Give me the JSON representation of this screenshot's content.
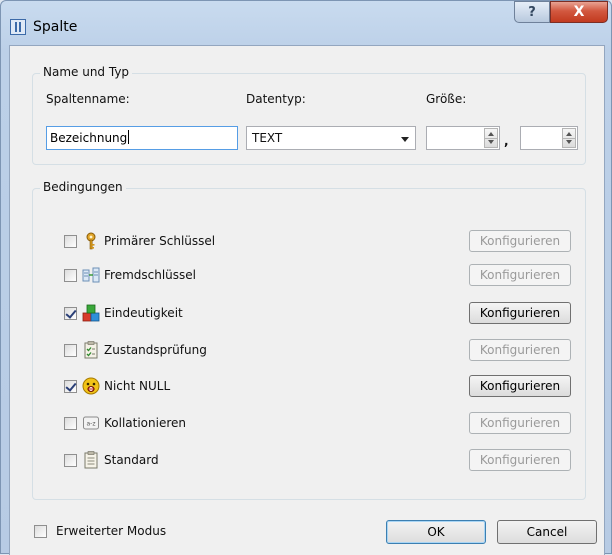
{
  "window": {
    "title": "Spalte",
    "help_label": "?",
    "close_label": "X"
  },
  "name_group": {
    "label": "Name und Typ",
    "column_name_label": "Spaltenname:",
    "column_name_value": "Bezeichnung",
    "datatype_label": "Datentyp:",
    "datatype_value": "TEXT",
    "size_label": "Größe:",
    "size_separator": ",",
    "size_value": "",
    "precision_value": ""
  },
  "constraints_group": {
    "label": "Bedingungen",
    "configure_label": "Konfigurieren",
    "items": [
      {
        "label": "Primärer Schlüssel",
        "checked": false,
        "icon": "key-icon",
        "configure_enabled": false
      },
      {
        "label": "Fremdschlüssel",
        "checked": false,
        "icon": "foreign-key-icon",
        "configure_enabled": false
      },
      {
        "label": "Eindeutigkeit",
        "checked": true,
        "icon": "unique-blocks-icon",
        "configure_enabled": true
      },
      {
        "label": "Zustandsprüfung",
        "checked": false,
        "icon": "check-list-icon",
        "configure_enabled": false
      },
      {
        "label": "Nicht NULL",
        "checked": true,
        "icon": "not-null-smiley-icon",
        "configure_enabled": true
      },
      {
        "label": "Kollationieren",
        "checked": false,
        "icon": "collate-az-icon",
        "configure_enabled": false
      },
      {
        "label": "Standard",
        "checked": false,
        "icon": "clipboard-icon",
        "configure_enabled": false
      }
    ]
  },
  "footer": {
    "advanced_mode_label": "Erweiterter Modus",
    "advanced_mode_checked": false,
    "ok_label": "OK",
    "cancel_label": "Cancel"
  },
  "colors": {
    "title_bar": "#c9dbef",
    "close_button": "#c94a2f",
    "focus_border": "#569de5",
    "dialog_face": "#f0f0f0"
  }
}
